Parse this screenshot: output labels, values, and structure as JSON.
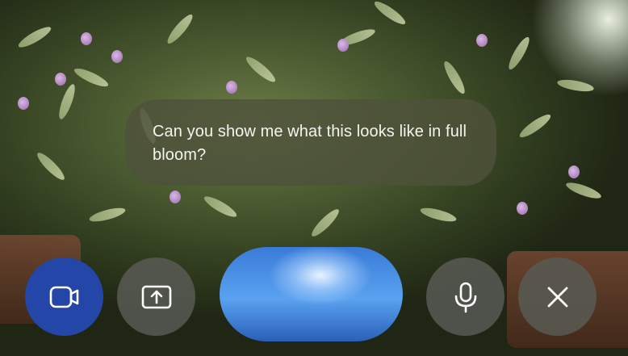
{
  "query": {
    "text": "Can you show me what this looks like in full bloom?"
  },
  "controls": {
    "camera_icon": "video-camera-icon",
    "share_icon": "screen-share-icon",
    "live_indicator": "live-orb",
    "mic_icon": "microphone-icon",
    "close_icon": "close-icon"
  },
  "colors": {
    "camera_active": "#2446a8",
    "control_gray": "#585a54",
    "bubble": "#4e523a",
    "orb": "#3a7bd8"
  }
}
